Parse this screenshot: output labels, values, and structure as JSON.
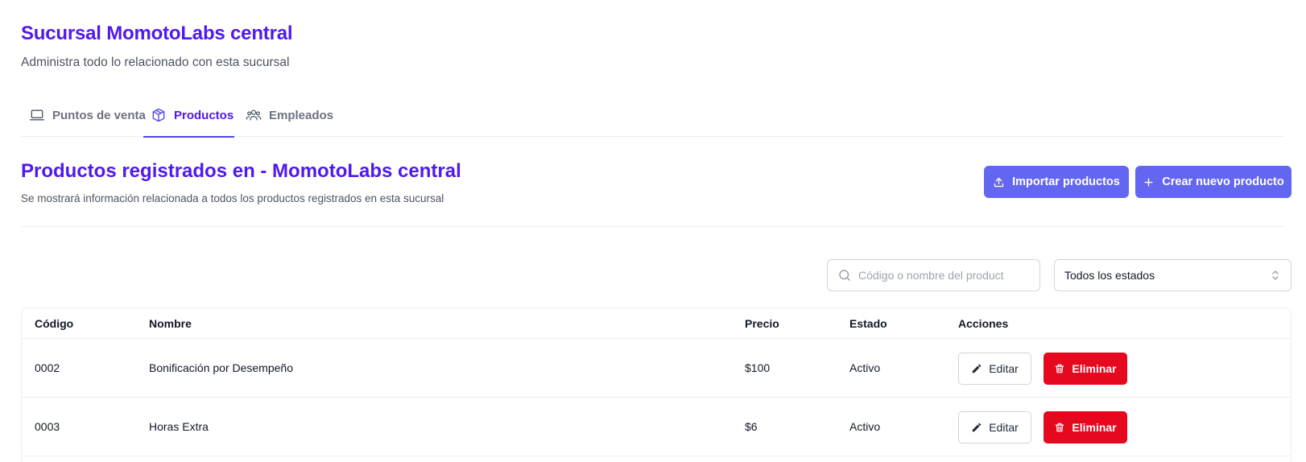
{
  "header": {
    "title": "Sucursal MomotoLabs central",
    "subtitle": "Administra todo lo relacionado con esta sucursal"
  },
  "tabs": [
    {
      "label": "Puntos de venta",
      "icon": "laptop-icon",
      "active": false
    },
    {
      "label": "Productos",
      "icon": "cube-icon",
      "active": true
    },
    {
      "label": "Empleados",
      "icon": "users-icon",
      "active": false
    }
  ],
  "section": {
    "title": "Productos registrados en - MomotoLabs central",
    "description": "Se mostrará información relacionada a todos los productos registrados en esta sucursal",
    "import_label": "Importar productos",
    "create_label": "Crear nuevo producto"
  },
  "filters": {
    "search_placeholder": "Código o nombre del product",
    "search_value": "",
    "status_selected": "Todos los estados"
  },
  "table": {
    "columns": [
      "Código",
      "Nombre",
      "Precio",
      "Estado",
      "Acciones"
    ],
    "rows": [
      {
        "codigo": "0002",
        "nombre": "Bonificación por Desempeño",
        "precio": "$100",
        "estado": "Activo"
      },
      {
        "codigo": "0003",
        "nombre": "Horas Extra",
        "precio": "$6",
        "estado": "Activo"
      }
    ],
    "edit_label": "Editar",
    "delete_label": "Eliminar"
  },
  "colors": {
    "brand": "#4f19f0",
    "primary_button": "#6366f1",
    "danger": "#e6081f",
    "muted_text": "#6b7280"
  }
}
